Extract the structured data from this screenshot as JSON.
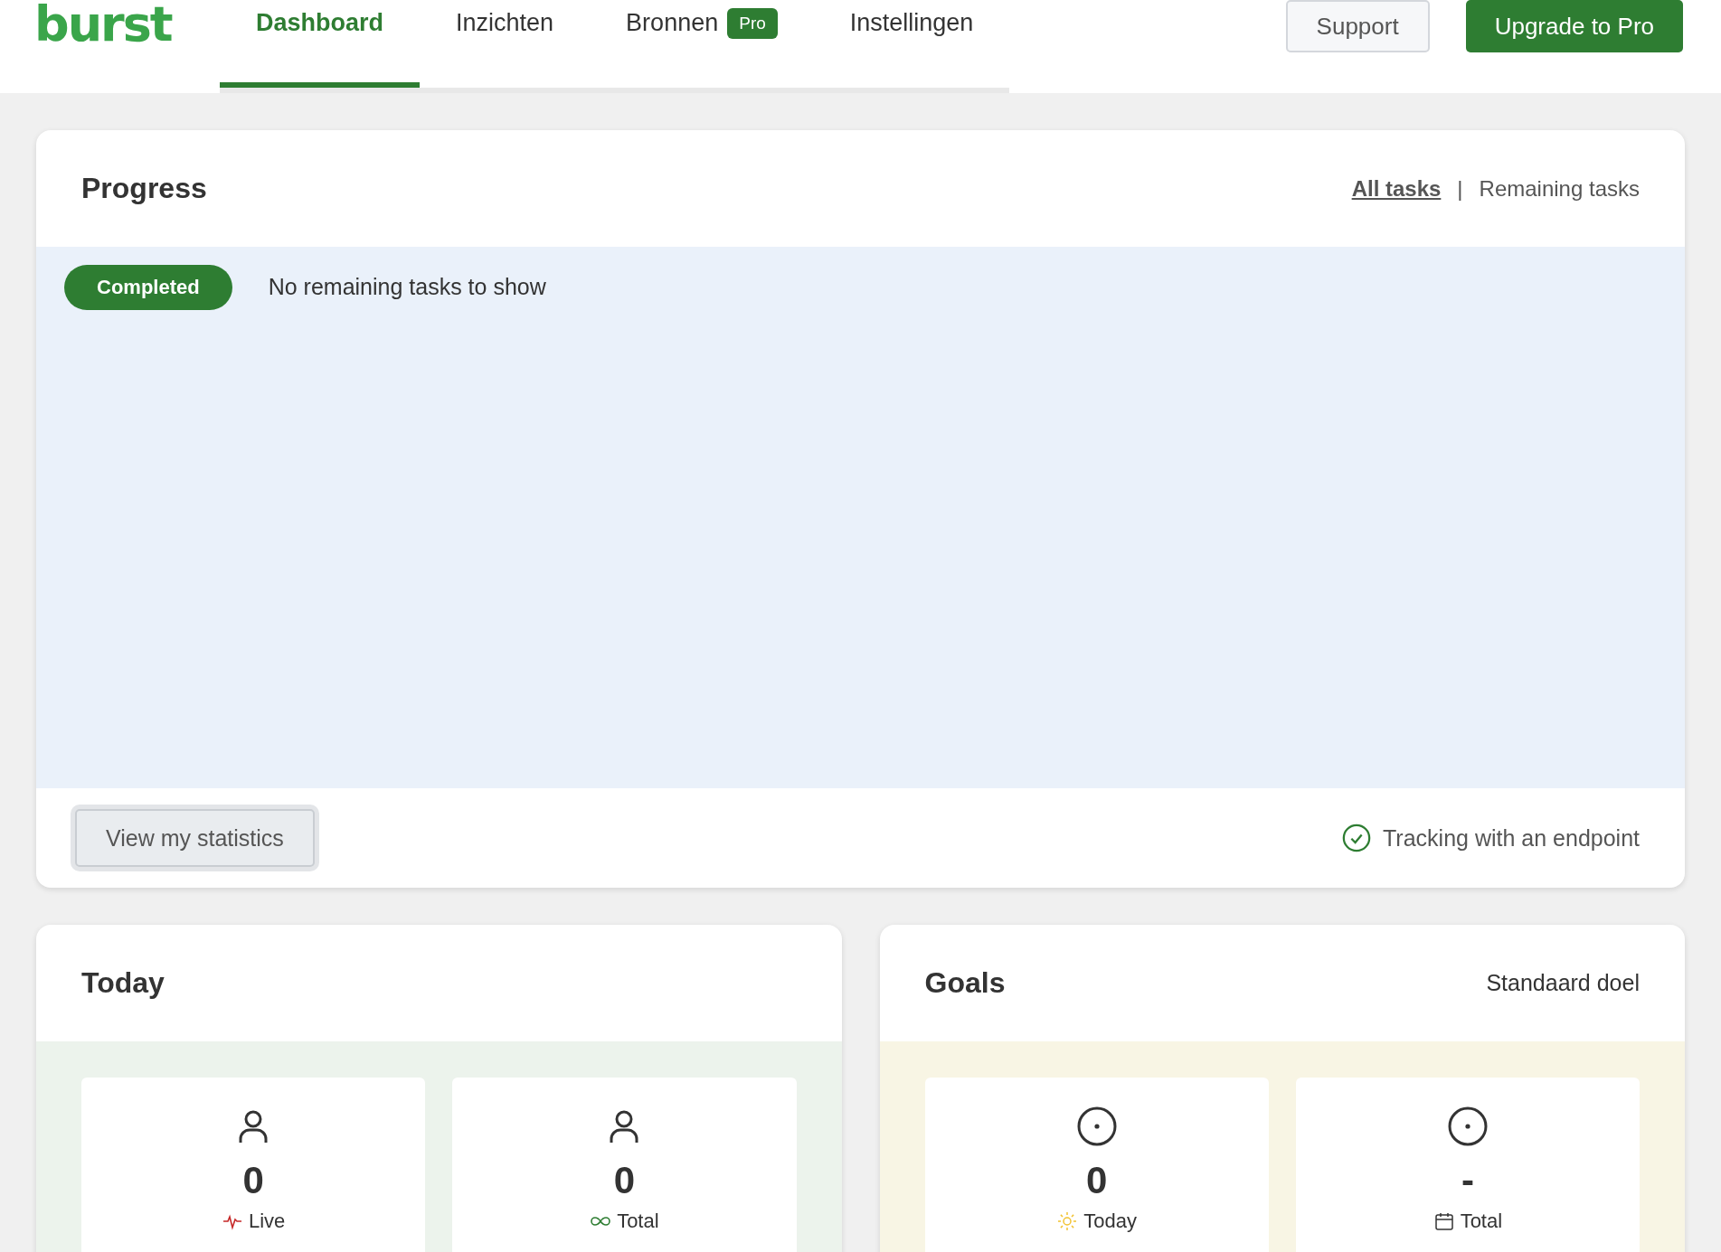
{
  "logo": "burst",
  "nav": [
    {
      "label": "Dashboard",
      "selected": true
    },
    {
      "label": "Inzichten",
      "selected": false
    },
    {
      "label": "Bronnen",
      "badge": "Pro",
      "selected": false
    },
    {
      "label": "Instellingen",
      "selected": false
    }
  ],
  "header_buttons": [
    {
      "label": "Support",
      "kind": "secondary"
    },
    {
      "label": "Upgrade to Pro",
      "kind": "primary"
    }
  ],
  "progress": {
    "title": "Progress",
    "filters": [
      {
        "label": "All tasks",
        "selected": true
      },
      {
        "label": "Remaining tasks",
        "selected": false
      }
    ],
    "separator": "|",
    "status": "Completed",
    "message": "No remaining tasks to show",
    "button": "View my statistics",
    "tracking": "Tracking with an endpoint"
  },
  "today": {
    "title": "Today",
    "stats": [
      {
        "value": "0",
        "label": "Live",
        "kind": "live"
      },
      {
        "value": "0",
        "label": "Total",
        "kind": "total"
      }
    ]
  },
  "goals": {
    "title": "Goals",
    "link": "Standaard doel",
    "stats": [
      {
        "value": "0",
        "label": "Today",
        "kind": "today"
      },
      {
        "value": "-",
        "label": "Total",
        "kind": "calendar"
      }
    ]
  }
}
